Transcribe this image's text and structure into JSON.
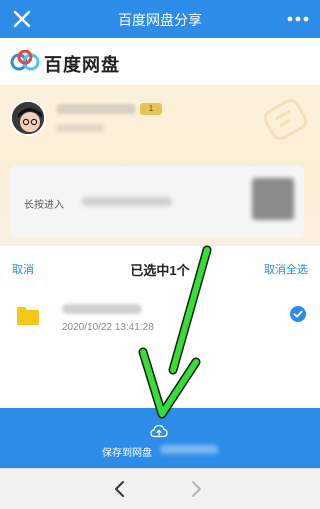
{
  "titlebar": {
    "title": "百度网盘分享"
  },
  "brand": {
    "name": "百度网盘"
  },
  "share_user": {
    "badge": "1"
  },
  "share_card": {
    "hint": "长按进入"
  },
  "selection": {
    "cancel_label": "取消",
    "count_label": "已选中1个",
    "clear_all_label": "取消全选"
  },
  "file": {
    "date": "2020/10/22 13:41:28",
    "selected": true
  },
  "save": {
    "label": "保存到网盘"
  },
  "colors": {
    "primary": "#2c8ce8",
    "folder": "#f5c518",
    "annotation_arrow": "#33e033"
  },
  "icons": {
    "close": "close-icon",
    "more": "more-icon",
    "logo": "baidu-netdisk-logo",
    "folder": "folder-icon",
    "check": "check-circle-icon",
    "cloud": "cloud-upload-icon",
    "back": "chevron-left-icon",
    "forward": "chevron-right-icon"
  }
}
